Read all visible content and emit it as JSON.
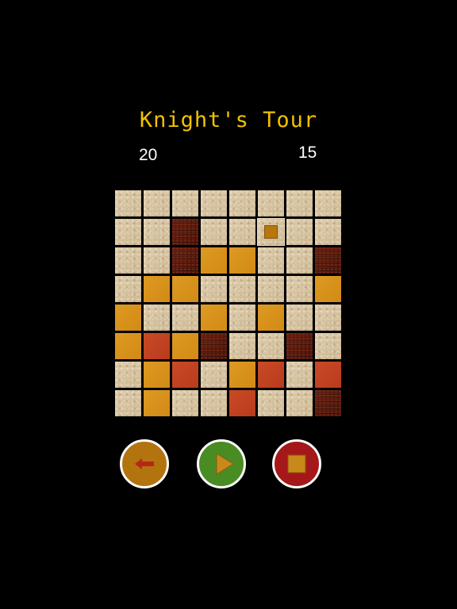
{
  "game": {
    "title": "Knight's Tour",
    "score_left": "20",
    "score_right": "15"
  },
  "board": {
    "size": 8,
    "current_position": {
      "row": 1,
      "col": 5
    },
    "rows": [
      [
        "sand",
        "sand",
        "sand",
        "sand",
        "sand",
        "sand",
        "sand",
        "sand"
      ],
      [
        "sand",
        "sand",
        "dark",
        "sand",
        "sand",
        "sand",
        "sand",
        "sand"
      ],
      [
        "sand",
        "sand",
        "dark",
        "gold",
        "gold",
        "sand",
        "sand",
        "dark"
      ],
      [
        "sand",
        "gold",
        "gold",
        "sand",
        "sand",
        "sand",
        "sand",
        "gold"
      ],
      [
        "gold",
        "sand",
        "sand",
        "gold",
        "sand",
        "gold",
        "sand",
        "sand"
      ],
      [
        "gold",
        "red",
        "gold",
        "dark",
        "sand",
        "sand",
        "dark",
        "sand"
      ],
      [
        "sand",
        "gold",
        "red",
        "sand",
        "gold",
        "red",
        "sand",
        "red"
      ],
      [
        "sand",
        "gold",
        "sand",
        "sand",
        "red",
        "sand",
        "sand",
        "dark"
      ]
    ]
  },
  "controls": {
    "back": {
      "icon": "arrow-left-icon",
      "fill": "#b3740f",
      "glyph": "#b8261a"
    },
    "play": {
      "icon": "play-icon",
      "fill": "#4a8c24",
      "glyph": "#c9891a"
    },
    "stop": {
      "icon": "stop-icon",
      "fill": "#a5181a",
      "glyph": "#c9891a"
    }
  },
  "colors": {
    "background": "#000000",
    "title": "#f2c200",
    "score": "#ffffff"
  }
}
